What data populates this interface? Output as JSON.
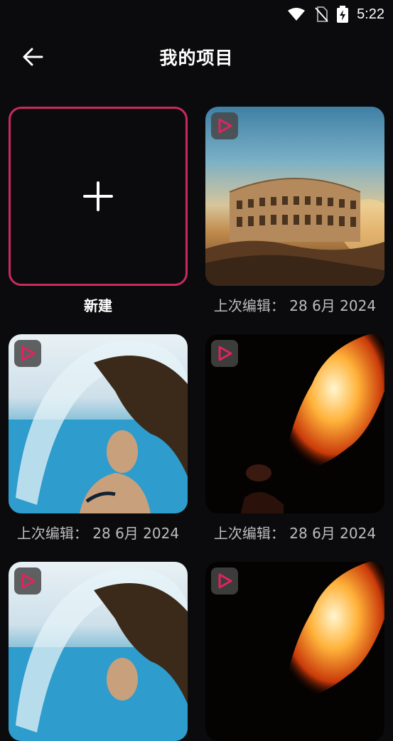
{
  "status": {
    "time": "5:22"
  },
  "header": {
    "title": "我的项目"
  },
  "new_project": {
    "label": "新建"
  },
  "projects": [
    {
      "caption": "上次编辑： 28 6月 2024",
      "image": "colosseum"
    },
    {
      "caption": "上次编辑： 28 6月 2024",
      "image": "water-hair"
    },
    {
      "caption": "上次编辑： 28 6月 2024",
      "image": "fire-breather"
    },
    {
      "caption": "",
      "image": "water-hair"
    },
    {
      "caption": "",
      "image": "fire-breather"
    }
  ],
  "colors": {
    "accent": "#c92a5c",
    "badge_play": "#e0245e",
    "background": "#0b0b0d"
  },
  "icons": {
    "back": "arrow-left-icon",
    "add": "plus-icon",
    "badge": "play-badge-icon"
  }
}
